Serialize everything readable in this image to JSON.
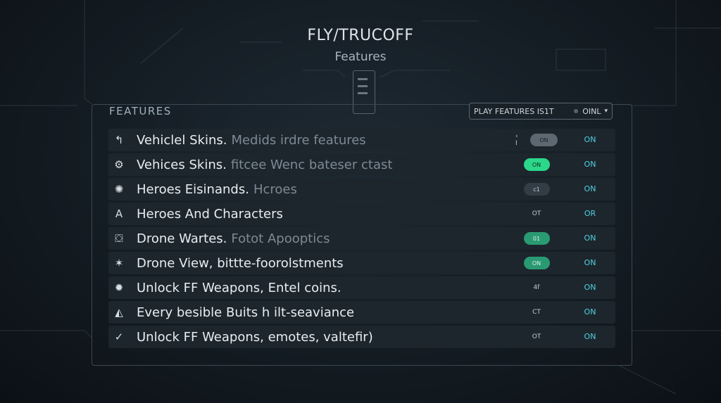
{
  "app": {
    "title": "FLY/TRUCOFF",
    "subtitle": "Features"
  },
  "section": {
    "title": "FEATURES"
  },
  "header_dropdown": {
    "label": "PLAY FEATURES IS1T",
    "value": "OINL"
  },
  "colors": {
    "accent_cyan": "#4fd1e0",
    "toggle_green": "#2bd88a",
    "toggle_teal": "#2a9a73"
  },
  "features": [
    {
      "icon": "hook-icon",
      "glyph": "↰",
      "label": "Vehiclel Skins.",
      "extra": "Medids irdre features",
      "toggle_text": "ON",
      "toggle_prefix": "‹ I",
      "toggle_style": "grey",
      "state": "ON"
    },
    {
      "icon": "gear-icon",
      "glyph": "⚙",
      "label": "Vehices Skins.",
      "extra": "fitcee Wenc bateser ctast",
      "toggle_text": "ON",
      "toggle_prefix": "",
      "toggle_style": "on-green",
      "state": "ON"
    },
    {
      "icon": "sun-icon",
      "glyph": "✺",
      "label": "Heroes Eisinands.",
      "extra": "Hcroes",
      "toggle_text": "c1",
      "toggle_prefix": "",
      "toggle_style": "dark",
      "state": "ON"
    },
    {
      "icon": "letter-a-icon",
      "glyph": "A",
      "label": "Heroes And Characters",
      "extra": "",
      "toggle_text": "OT",
      "toggle_prefix": "",
      "toggle_style": "plain",
      "state": "OR"
    },
    {
      "icon": "drone-icon",
      "glyph": "⛋",
      "label": "Drone Wartes.",
      "extra": "Fotot Apooptics",
      "toggle_text": "01",
      "toggle_prefix": "",
      "toggle_style": "on-teal",
      "state": "ON"
    },
    {
      "icon": "person-icon",
      "glyph": "✶",
      "label": "Drone View, bittte-foorolstments",
      "extra": "",
      "toggle_text": "ON",
      "toggle_prefix": "",
      "toggle_style": "on-teal",
      "state": "ON"
    },
    {
      "icon": "virus-icon",
      "glyph": "✹",
      "label": "Unlock FF Weapons, Entel coins.",
      "extra": "",
      "toggle_text": "4f",
      "toggle_prefix": "",
      "toggle_style": "plain",
      "state": "ON"
    },
    {
      "icon": "triangle-icon",
      "glyph": "◭",
      "label": "Every besible Buits h ilt-seaviance",
      "extra": "",
      "toggle_text": "CT",
      "toggle_prefix": "",
      "toggle_style": "plain",
      "state": "ON"
    },
    {
      "icon": "check-icon",
      "glyph": "✓",
      "label": "Unlock FF Weapons, emotes, valtefir)",
      "extra": "",
      "toggle_text": "OT",
      "toggle_prefix": "",
      "toggle_style": "plain",
      "state": "ON"
    }
  ]
}
